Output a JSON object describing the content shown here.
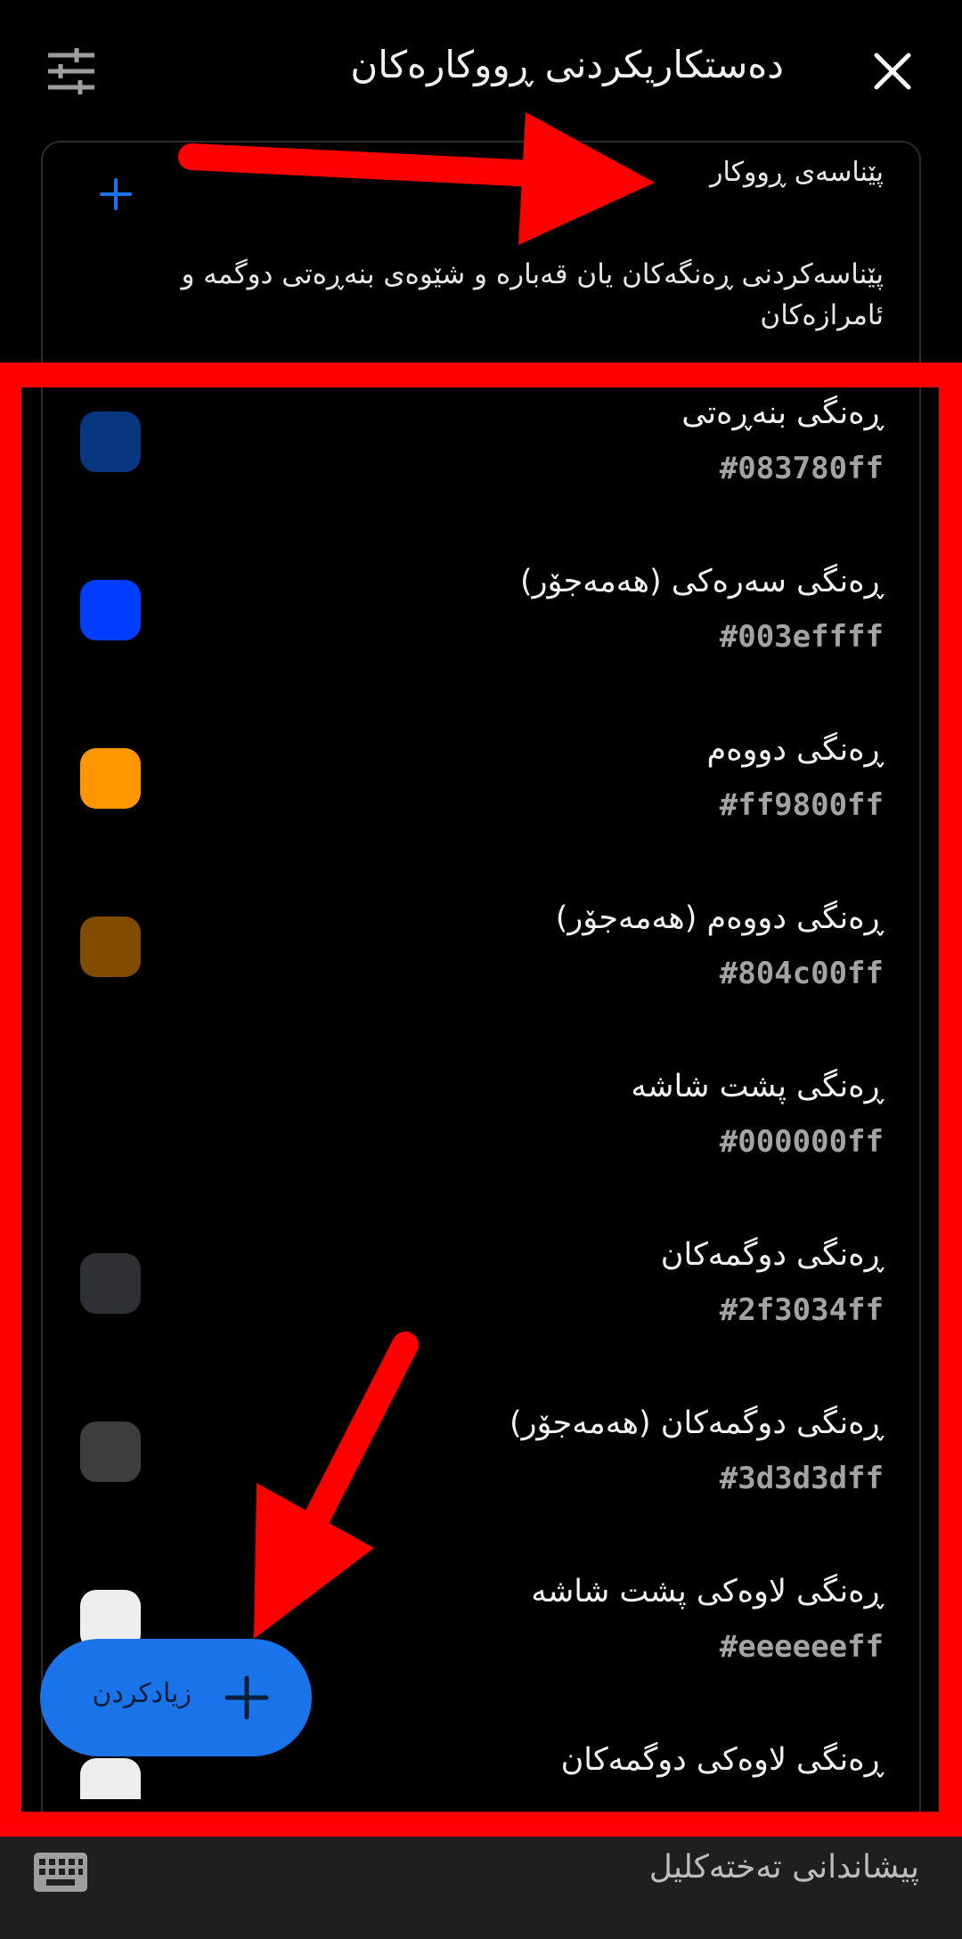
{
  "header": {
    "title": "دەستکاریکردنی ڕووکارەکان",
    "settings_icon": "tune-icon",
    "close_icon": "close-icon"
  },
  "definition": {
    "title": "پێناسەی ڕووکار",
    "description": "پێناسەکردنی ڕەنگەکان یان قەبارە و شێوەی بنەڕەتی دوگمە و ئامرازەکان",
    "add_icon": "plus-icon"
  },
  "colors": [
    {
      "name": "ڕەنگی بنەڕەتی",
      "hex": "#083780ff",
      "swatch": "#083780"
    },
    {
      "name": "ڕەنگی سەرەکی (هەمەجۆر)",
      "hex": "#003effff",
      "swatch": "#003eff"
    },
    {
      "name": "ڕەنگی دووەم",
      "hex": "#ff9800ff",
      "swatch": "#ff9800"
    },
    {
      "name": "ڕەنگی دووەم (هەمەجۆر)",
      "hex": "#804c00ff",
      "swatch": "#804c00"
    },
    {
      "name": "ڕەنگی پشت شاشە",
      "hex": "#000000ff",
      "swatch": "#000000"
    },
    {
      "name": "ڕەنگی دوگمەکان",
      "hex": "#2f3034ff",
      "swatch": "#2f3034"
    },
    {
      "name": "ڕەنگی دوگمەکان (هەمەجۆر)",
      "hex": "#3d3d3dff",
      "swatch": "#3d3d3d"
    },
    {
      "name": "ڕەنگی لاوەکی پشت شاشە",
      "hex": "#eeeeeeff",
      "swatch": "#eeeeee"
    },
    {
      "name": "ڕەنگی لاوەکی دوگمەکان",
      "hex": "",
      "swatch": "#eeeeee"
    }
  ],
  "fab": {
    "label": "زیادکردن",
    "icon": "plus-icon"
  },
  "bottom_bar": {
    "label": "پیشاندانی تەختەکلیل",
    "icon": "keyboard-icon"
  },
  "accent": "#1a73e8",
  "annotation_color": "#ff0000"
}
